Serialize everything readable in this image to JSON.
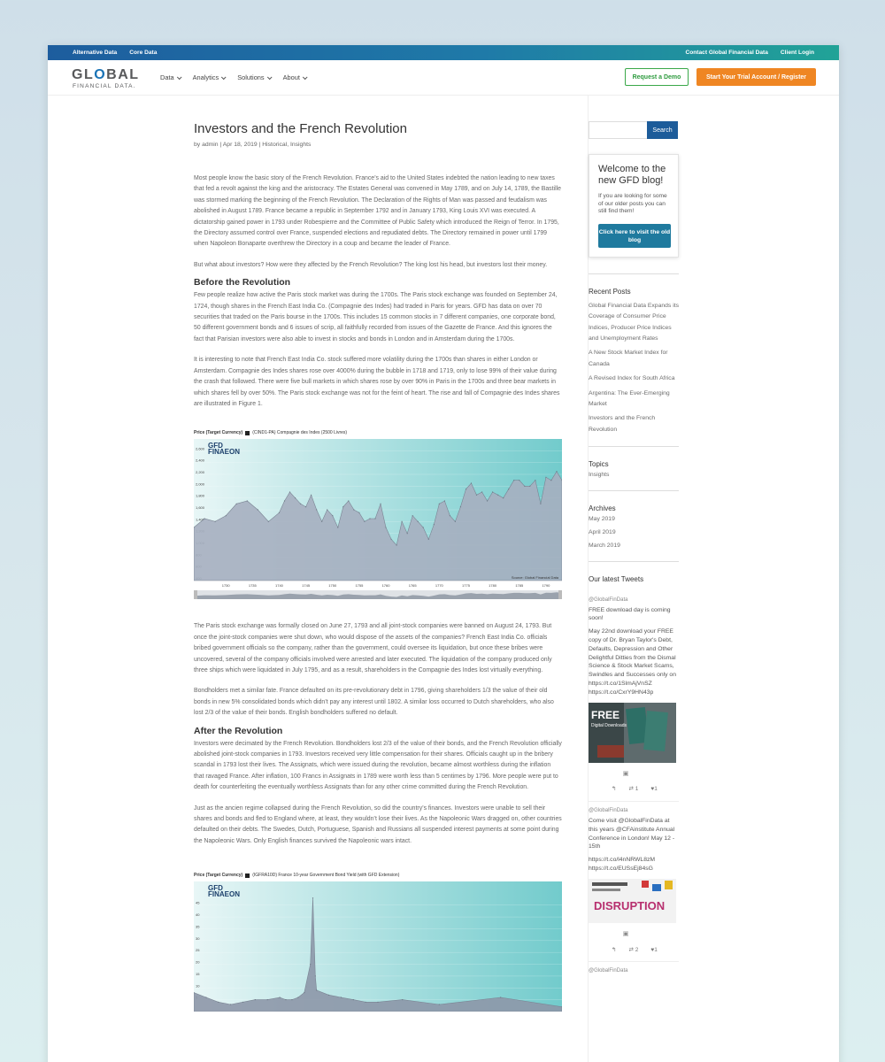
{
  "topbar": {
    "left": [
      "Alternative Data",
      "Core Data"
    ],
    "right": [
      "Contact Global Financial Data",
      "Client Login"
    ]
  },
  "logo": {
    "word_pre": "GL",
    "word_o": "O",
    "word_post": "BAL",
    "sub": "FINANCIAL DATA."
  },
  "nav": [
    "Data",
    "Analytics",
    "Solutions",
    "About"
  ],
  "cta": {
    "demo": "Request a Demo",
    "trial": "Start Your Trial Account / Register"
  },
  "post": {
    "title": "Investors and the French Revolution",
    "meta_by": "by ",
    "author": "admin",
    "date": " | Apr 18, 2019 | ",
    "cat1": "Historical",
    "cat2": "Insights",
    "p1": "Most people know the basic story of the French Revolution.  France’s aid to the United States indebted the nation leading to new taxes that fed a revolt against the king and the aristocracy. The Estates General was convened in May 1789, and on July 14, 1789, the Bastille was stormed marking the beginning of the French Revolution. The Declaration of the Rights of Man was passed and feudalism was abolished in August 1789. France became a republic in September 1792 and in January 1793, King Louis XVI was executed. A dictatorship gained power in 1793 under Robespierre and the Committee of Public Safety which introduced the Reign of Terror. In 1795, the Directory assumed control over France, suspended elections and repudiated debts. The Directory remained in power until 1799 when Napoleon Bonaparte overthrew the Directory in a coup and became the leader of France.",
    "p2": "But what about investors?  How were they affected by the French Revolution? The king lost his head, but investors lost their money.",
    "h_before": "Before the Revolution",
    "p3": "Few people realize how active the Paris stock market was during the 1700s. The Paris stock exchange was founded on September 24, 1724, though shares in the French East India Co. (Compagnie des Indes) had traded in Paris for years.   GFD has data on over 70 securities that traded on the Paris bourse in the 1700s.  This includes 15 common stocks in 7 different companies, one corporate bond, 50 different government bonds and 6 issues of scrip, all faithfully recorded from issues of the Gazette de France. And this ignores the fact that Parisian investors were also able to invest in stocks and bonds in London and in Amsterdam during the 1700s.",
    "p4": "It is interesting to note that French East India Co. stock suffered more volatility during the 1700s than shares in either London or Amsterdam.  Compagnie des Indes shares rose over 4000% during the bubble in 1718 and 1719, only to lose 99% of their value during the crash that followed. There were five bull markets in which shares rose by over 90% in Paris in the 1700s and three bear markets in which shares fell by over 50%.  The Paris stock exchange was not for the feint of heart.  The rise and fall of Compagnie des Indes shares are illustrated in Figure 1.",
    "p5": "The Paris stock exchange was formally closed on June 27, 1793 and all joint-stock companies were banned on August 24, 1793. But once the joint-stock companies were shut down, who would dispose of the assets of the companies? French East India Co. officials bribed government officials so the company, rather than the government, could oversee its liquidation, but once these bribes were uncovered, several of the company officials involved were arrested and later executed. The liquidation of the company produced only three ships which were liquidated in July 1795, and as a result, shareholders in the Compagnie des Indes lost virtually everything.",
    "p6": "Bondholders met a similar fate. France defaulted on its pre-revolutionary debt in 1796, giving shareholders 1/3 the value of their old bonds in new 5% consolidated bonds which didn’t pay any interest until 1802.   A similar loss occurred to Dutch shareholders, who also lost 2/3 of the value of their bonds.  English bondholders suffered no default.",
    "h_after": "After the Revolution",
    "p7": "Investors were decimated by the French Revolution.  Bondholders lost 2/3 of the value of their bonds, and the French Revolution officially abolished joint-stock companies in 1793.  Investors received very little compensation for their shares. Officials caught up in the bribery scandal in 1793 lost their lives. The Assignats, which were issued during the revolution, became almost worthless during the inflation that ravaged France.  After inflation, 100 Francs in Assignats in 1789 were worth less than 5 centimes by 1796. More people were put to death for counterfeiting the eventually worthless Assignats than for any other crime committed during the French Revolution.",
    "p8": "Just as the ancien regime collapsed during the French Revolution, so did the country’s finances.  Investors were unable to sell their shares and bonds and fled to England where, at least, they wouldn’t lose their lives. As the Napoleonic Wars dragged on, other countries defaulted on their debts. The Swedes, Dutch, Portuguese, Spanish and Russians all suspended interest payments at some point during the Napoleonic Wars.  Only English finances survived the Napoleonic wars intact."
  },
  "chart_data": [
    {
      "type": "area",
      "title": "Price (Target Currency)",
      "legend": "(CIND1-PA) Compagnie des Indes (2500 Livres)",
      "brand": "GFD FINAEON",
      "source": "Source: Global Financial Data",
      "x": [
        1724,
        1726,
        1728,
        1730,
        1732,
        1734,
        1736,
        1738,
        1740,
        1741,
        1742,
        1743,
        1744,
        1745,
        1746,
        1747,
        1748,
        1749,
        1750,
        1751,
        1752,
        1753,
        1754,
        1755,
        1756,
        1757,
        1758,
        1759,
        1760,
        1761,
        1762,
        1763,
        1764,
        1765,
        1766,
        1767,
        1768,
        1769,
        1770,
        1771,
        1772,
        1773,
        1774,
        1775,
        1776,
        1777,
        1778,
        1779,
        1780,
        1781,
        1782,
        1783,
        1784,
        1785,
        1786,
        1787,
        1788,
        1789,
        1790,
        1791,
        1792,
        1793
      ],
      "values": [
        1300,
        1450,
        1400,
        1500,
        1700,
        1750,
        1600,
        1400,
        1550,
        1750,
        1900,
        1800,
        1700,
        1650,
        1850,
        1600,
        1400,
        1600,
        1500,
        1300,
        1650,
        1750,
        1600,
        1550,
        1400,
        1450,
        1450,
        1700,
        1300,
        1100,
        1000,
        1400,
        1200,
        1500,
        1400,
        1300,
        1100,
        1350,
        1700,
        1750,
        1500,
        1400,
        1650,
        1950,
        2050,
        1850,
        1900,
        1750,
        1900,
        1850,
        1800,
        1950,
        2100,
        2100,
        2000,
        2000,
        2100,
        1700,
        2150,
        2100,
        2250,
        2100
      ],
      "ylim": [
        400,
        2800
      ],
      "yticks": [
        "400",
        "600",
        "800",
        "1,000",
        "1,200",
        "1,400",
        "1,600",
        "1,800",
        "2,000",
        "2,200",
        "2,400",
        "2,600"
      ],
      "xticks": [
        "1730",
        "1735",
        "1740",
        "1745",
        "1750",
        "1755",
        "1760",
        "1765",
        "1770",
        "1775",
        "1780",
        "1785",
        "1790"
      ]
    },
    {
      "type": "area",
      "title": "Price (Target Currency)",
      "legend": "(IGFRA10D) France 10-year Government Bond Yield (with GFD Extension)",
      "brand": "GFD FINAEON",
      "x": [
        1700,
        1710,
        1720,
        1730,
        1740,
        1750,
        1760,
        1770,
        1775,
        1780,
        1785,
        1790,
        1795,
        1797,
        1799,
        1800,
        1810,
        1820,
        1830,
        1840,
        1850,
        1870,
        1900,
        1950,
        2000
      ],
      "values": [
        8,
        6,
        4,
        3,
        4,
        5,
        5,
        6,
        5,
        5,
        6,
        8,
        20,
        48,
        15,
        9,
        7,
        6,
        5,
        4,
        4,
        5,
        3,
        6,
        2
      ],
      "ylim": [
        0,
        55
      ],
      "yticks": [
        "5",
        "10",
        "15",
        "20",
        "25",
        "30",
        "35",
        "40",
        "45"
      ]
    }
  ],
  "sidebar": {
    "search_placeholder": "",
    "search_btn": "Search",
    "welcome_title": "Welcome to the new GFD blog!",
    "welcome_desc": "If you are looking for some of our older posts you can still find them!",
    "welcome_btn": "Click here to visit the old blog",
    "recent_head": "Recent Posts",
    "recent": [
      "Global Financial Data Expands its Coverage of Consumer Price Indices, Producer Price Indices and Unemployment Rates",
      "A New Stock Market Index for Canada",
      "A Revised Index for South Africa",
      "Argentina: The Ever-Emerging Market",
      "Investors and the French Revolution"
    ],
    "topics_head": "Topics",
    "topics": [
      "Insights"
    ],
    "archives_head": "Archives",
    "archives": [
      "May 2019",
      "April 2019",
      "March 2019"
    ],
    "tweets_head": "Our latest Tweets",
    "tweets": [
      {
        "handle": "@GlobalFinData",
        "body1": "FREE download day is coming soon!",
        "body2": "May 22nd download your FREE copy of Dr. Bryan Taylor's Debt, Defaults, Depression and Other Delightful Ditties from the Dismal Science & Stock Market Scams, Swindles and Successes only on https://t.co/1SlmAjVnSZ https://t.co/CxrY9HN43p",
        "img_text": "FREE",
        "img_sub": "Digital Downloads",
        "retweets": "1",
        "likes": "1"
      },
      {
        "handle": "@GlobalFinData",
        "body1": "Come visit @GlobalFinData at this years @CFAinstitute Annual Conference in London! May 12 - 15th",
        "body2": "https://t.co/l4nNRWL8zM https://t.co/EUSsEj84sG",
        "img_text": "DISRUPTION",
        "retweets": "2",
        "likes": "1"
      }
    ],
    "tweet3_handle": "@GlobalFinData"
  },
  "colors": {
    "topbar_start": "#1d5d9e",
    "topbar_end": "#21a397",
    "demo": "#3aa849",
    "trial": "#ef8623",
    "search": "#1d5c9a",
    "chart_fill": "#9aa6b7",
    "chart_bg": "#7ccfd0"
  }
}
